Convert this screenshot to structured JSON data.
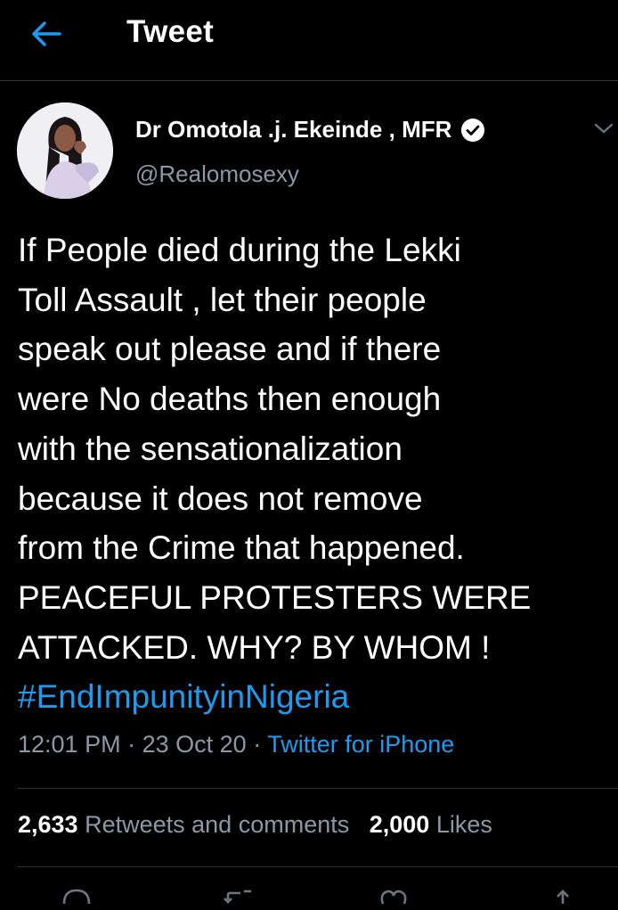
{
  "header": {
    "title": "Tweet"
  },
  "tweet": {
    "author_name": "Dr Omotola .j. Ekeinde , MFR",
    "handle": "@Realomosexy",
    "text": "If People died during the Lekki\nToll Assault , let their people\nspeak out please and if there\nwere No deaths then enough\nwith the sensationalization\nbecause it does not remove\nfrom the Crime that happened.\nPEACEFUL PROTESTERS WERE\nATTACKED. WHY? BY WHOM !",
    "hashtag": "#EndImpunityinNigeria",
    "time": "12:01 PM",
    "dot": "·",
    "date": "23 Oct 20",
    "source": "Twitter for iPhone"
  },
  "stats": {
    "retweets_count": "2,633",
    "retweets_label": "Retweets and comments",
    "likes_count": "2,000",
    "likes_label": "Likes"
  },
  "icons": {
    "back": "arrow-left-icon",
    "verified": "verified-badge-icon",
    "caret": "chevron-down-icon",
    "reply": "reply-icon",
    "retweet": "retweet-icon",
    "like": "heart-icon",
    "share": "share-icon"
  },
  "colors": {
    "background": "#000000",
    "accent": "#1d9bf0",
    "secondary_text": "#8b98a5",
    "divider": "#2f3336"
  }
}
